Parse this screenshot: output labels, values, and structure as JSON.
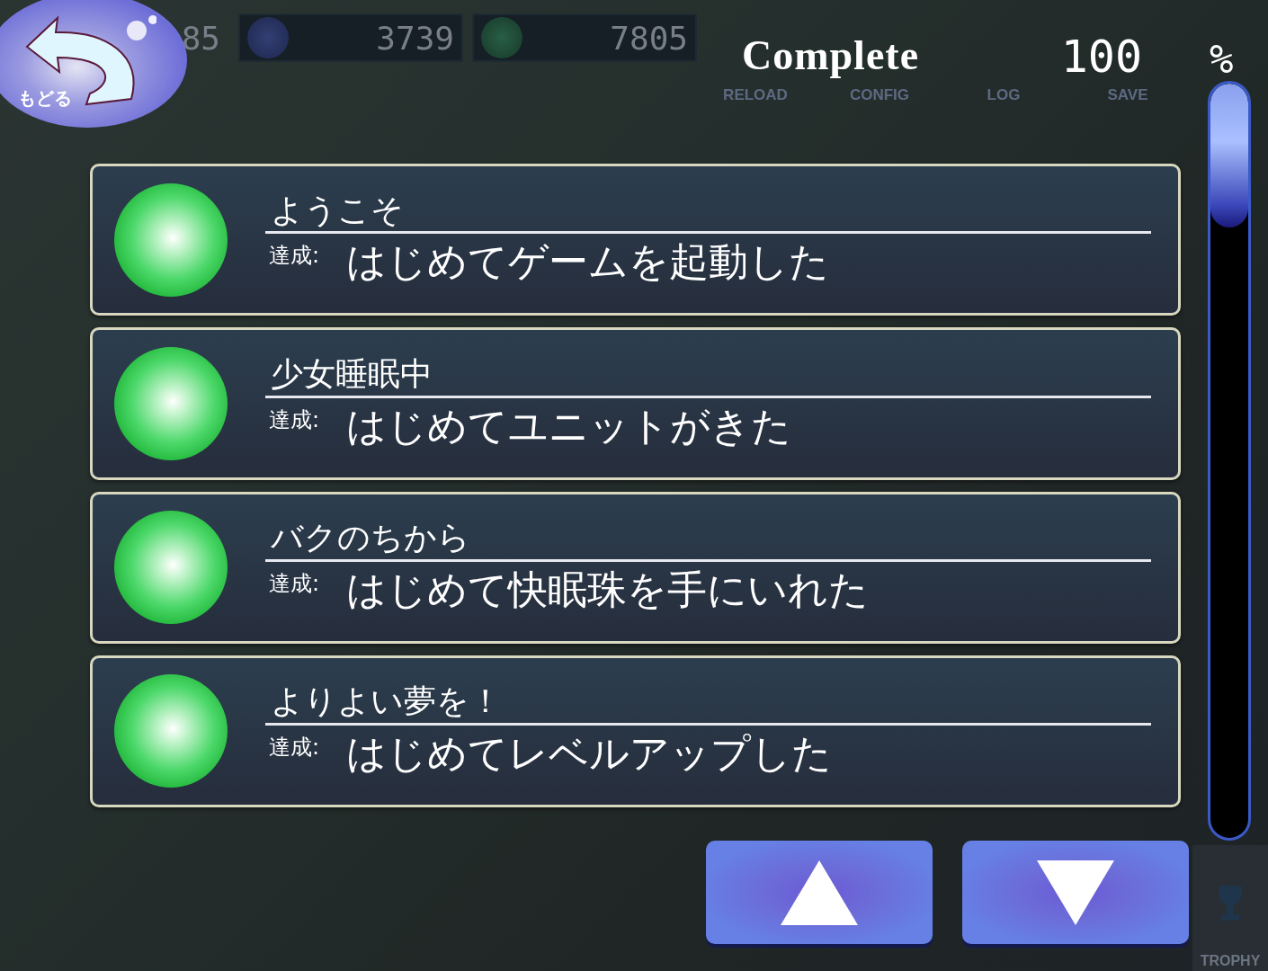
{
  "back_button": {
    "label": "もどる"
  },
  "hud": {
    "counters": [
      {
        "value": "85"
      },
      {
        "value": "3739"
      },
      {
        "value": "7805"
      }
    ],
    "menu": [
      {
        "label": "RELOAD"
      },
      {
        "label": "CONFIG"
      },
      {
        "label": "LOG"
      },
      {
        "label": "SAVE"
      }
    ],
    "trophy": {
      "label": "TROPHY"
    }
  },
  "progress": {
    "title": "Complete",
    "value": "100",
    "unit": "%"
  },
  "achievements": [
    {
      "title": "ようこそ",
      "prefix": "達成:",
      "description": "はじめてゲームを起動した",
      "achieved": true
    },
    {
      "title": "少女睡眠中",
      "prefix": "達成:",
      "description": "はじめてユニットがきた",
      "achieved": true
    },
    {
      "title": "バクのちから",
      "prefix": "達成:",
      "description": "はじめて快眠珠を手にいれた",
      "achieved": true
    },
    {
      "title": "よりよい夢を！",
      "prefix": "達成:",
      "description": "はじめてレベルアップした",
      "achieved": true
    }
  ],
  "scroll_buttons": [
    {
      "kind": "up"
    },
    {
      "kind": "down"
    }
  ]
}
